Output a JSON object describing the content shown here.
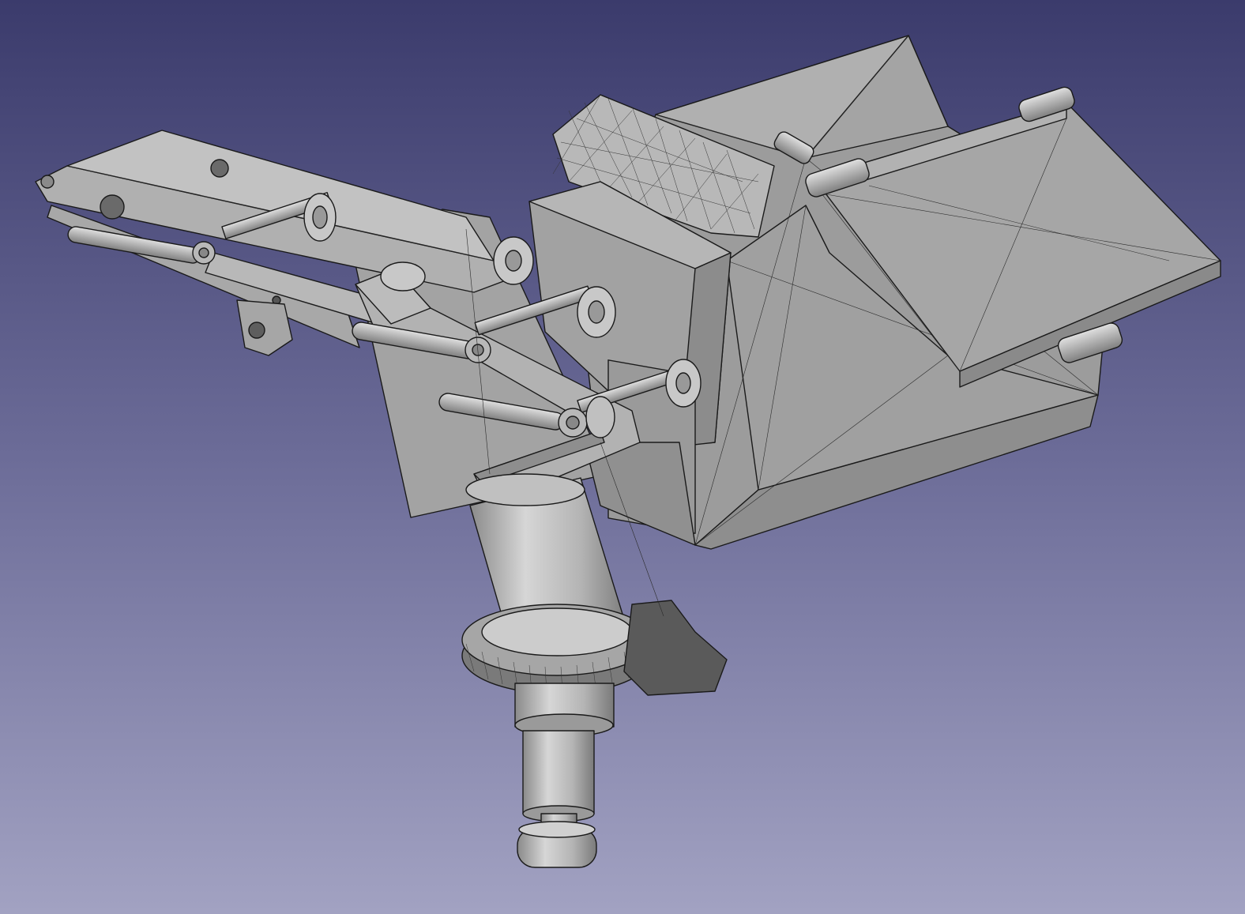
{
  "window": {
    "view": "3d-viewport"
  },
  "colors": {
    "background_top": "#3b3b6c",
    "background_mid": "#6c6c98",
    "background_bottom": "#a2a2c2",
    "part_fill": "#a9a9a9",
    "part_light": "#c4c4c4",
    "part_dark": "#7e7e7e",
    "edge": "#1a1a1a"
  },
  "icons": {
    "model": "cad-assembly-icon"
  }
}
